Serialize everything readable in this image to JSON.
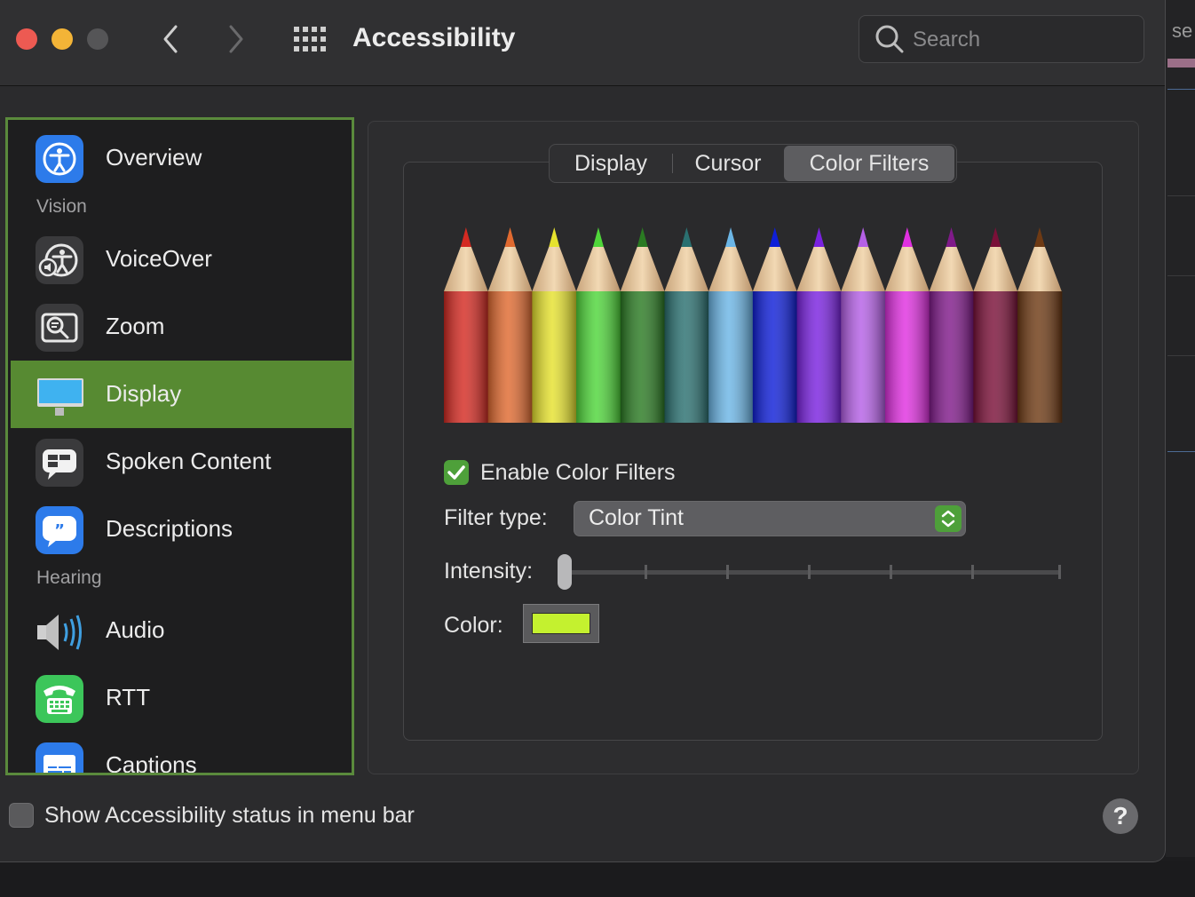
{
  "window": {
    "title": "Accessibility"
  },
  "search": {
    "placeholder": "Search"
  },
  "background_window": {
    "partial_text": "se"
  },
  "sidebar": {
    "items": [
      {
        "label": "Overview",
        "icon": "accessibility-icon"
      },
      {
        "label": "VoiceOver",
        "icon": "voiceover-icon"
      },
      {
        "label": "Zoom",
        "icon": "zoom-icon"
      },
      {
        "label": "Display",
        "icon": "display-icon",
        "selected": true
      },
      {
        "label": "Spoken Content",
        "icon": "spoken-content-icon"
      },
      {
        "label": "Descriptions",
        "icon": "descriptions-icon"
      },
      {
        "label": "Audio",
        "icon": "speaker-icon"
      },
      {
        "label": "RTT",
        "icon": "rtt-phone-icon"
      },
      {
        "label": "Captions",
        "icon": "captions-icon"
      }
    ],
    "sections": {
      "vision": "Vision",
      "hearing": "Hearing"
    }
  },
  "tabs": [
    {
      "label": "Display"
    },
    {
      "label": "Cursor"
    },
    {
      "label": "Color Filters",
      "active": true
    }
  ],
  "color_filters": {
    "enable_label": "Enable Color Filters",
    "enabled": true,
    "filter_type_label": "Filter type:",
    "filter_type_value": "Color Tint",
    "intensity_label": "Intensity:",
    "intensity_value": 0,
    "color_label": "Color:",
    "color_value": "#c4f12f",
    "pencil_colors": [
      "#d42a22",
      "#e06a30",
      "#e6e22e",
      "#4fd63a",
      "#2a7a22",
      "#2a7070",
      "#6cb6e6",
      "#0f1fd8",
      "#7a22e0",
      "#b560e6",
      "#e030e0",
      "#801a8a",
      "#7a1038",
      "#6e3a14"
    ]
  },
  "footer": {
    "status_menu_label": "Show Accessibility status in menu bar",
    "status_menu_checked": false,
    "help_label": "?"
  },
  "colors": {
    "accent": "#578a32",
    "checkbox_green": "#4ea03a"
  }
}
